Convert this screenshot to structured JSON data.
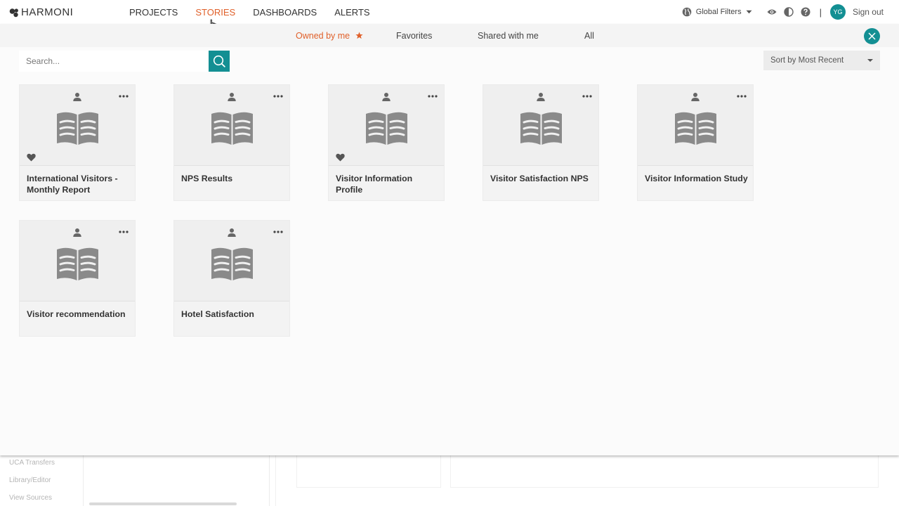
{
  "app": {
    "brand": "HARMONI"
  },
  "nav": {
    "items": [
      {
        "label": "PROJECTS",
        "active": false
      },
      {
        "label": "STORIES",
        "active": true
      },
      {
        "label": "DASHBOARDS",
        "active": false
      },
      {
        "label": "ALERTS",
        "active": false
      }
    ]
  },
  "header": {
    "global_filters_label": "Global Filters",
    "avatar_initials": "YG",
    "signout_label": "Sign out",
    "separator": "|",
    "icons": [
      "globe-icon",
      "chevron-down-icon",
      "eye-icon",
      "contrast-icon",
      "help-icon"
    ]
  },
  "stories": {
    "tabs": [
      {
        "label": "Owned by me",
        "active": true
      },
      {
        "label": "Favorites",
        "active": false
      },
      {
        "label": "Shared with me",
        "active": false
      },
      {
        "label": "All",
        "active": false
      }
    ],
    "search": {
      "placeholder": "Search...",
      "value": ""
    },
    "sort": {
      "selected": "Sort by Most Recent"
    },
    "cards": [
      {
        "title": "International Visitors - Monthly Report",
        "favorite": true
      },
      {
        "title": "NPS Results",
        "favorite": false
      },
      {
        "title": "Visitor Information Profile",
        "favorite": true
      },
      {
        "title": "Visitor Satisfaction NPS",
        "favorite": false
      },
      {
        "title": "Visitor Information Study",
        "favorite": false
      },
      {
        "title": "Visitor recommendation",
        "favorite": false
      },
      {
        "title": "Hotel Satisfaction",
        "favorite": false
      }
    ]
  },
  "background": {
    "sidebar_items": [
      "UCA Transfers",
      "Library/Editor",
      "View Sources"
    ]
  },
  "colors": {
    "accent": "#e0602a",
    "teal": "#138f93",
    "icon_gray": "#8a8a8a"
  }
}
